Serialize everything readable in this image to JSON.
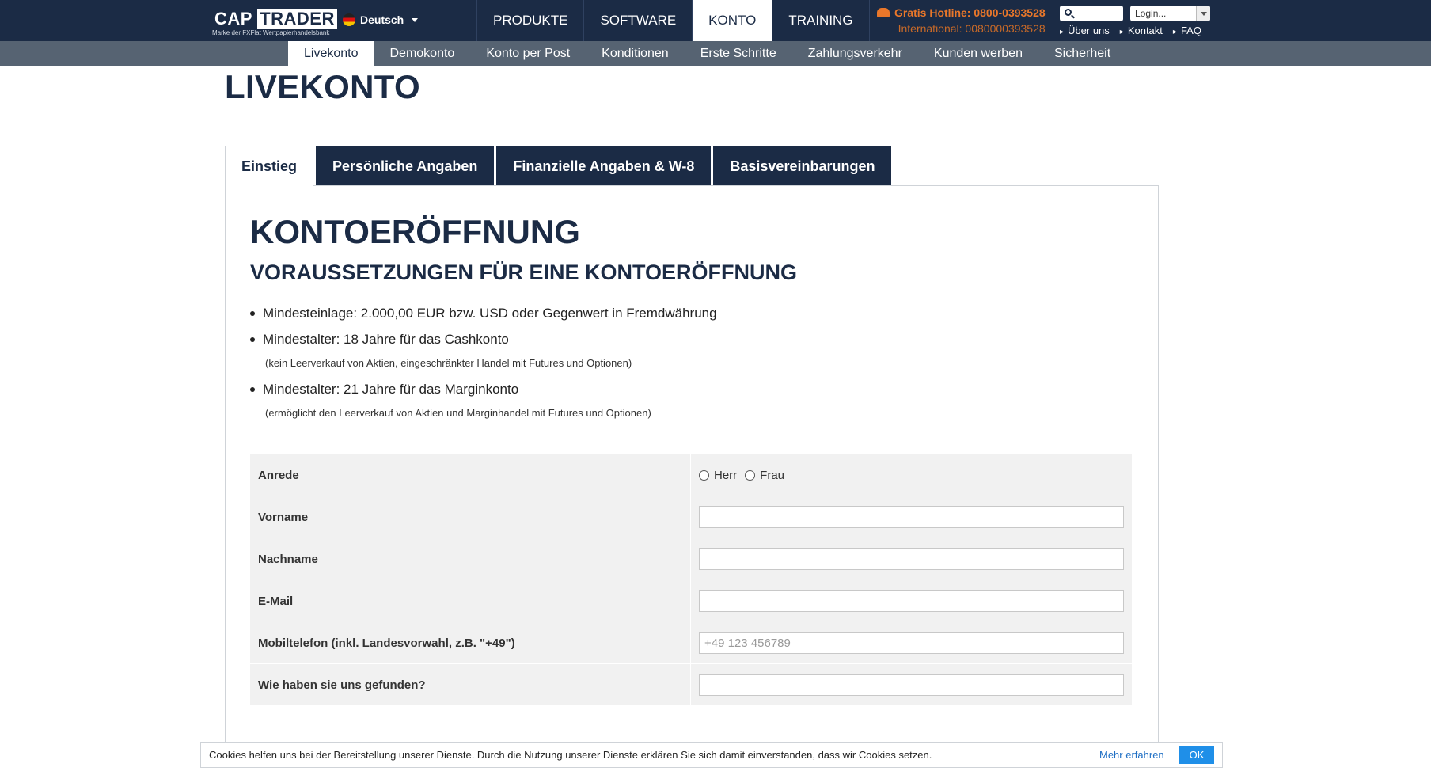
{
  "header": {
    "logo": {
      "brand_cap": "CAP",
      "brand_trader": "TRADER",
      "tagline": "Marke der FXFlat Wertpapierhandelsbank"
    },
    "language": "Deutsch",
    "main_nav": [
      "PRODUKTE",
      "SOFTWARE",
      "KONTO",
      "TRAINING"
    ],
    "active_main_nav": "KONTO",
    "hotline": "Gratis Hotline: 0800-0393528",
    "international": "International: 0080000393528",
    "search_placeholder": "",
    "login_label": "Login...",
    "top_links": [
      "Über uns",
      "Kontakt",
      "FAQ"
    ]
  },
  "subnav": {
    "items": [
      "Livekonto",
      "Demokonto",
      "Konto per Post",
      "Konditionen",
      "Erste Schritte",
      "Zahlungsverkehr",
      "Kunden werben",
      "Sicherheit"
    ],
    "active": "Livekonto"
  },
  "page_title": "LIVEKONTO",
  "tabs": [
    "Einstieg",
    "Persönliche Angaben",
    "Finanzielle Angaben & W-8",
    "Basisvereinbarungen"
  ],
  "active_tab": "Einstieg",
  "content": {
    "heading": "KONTOERÖFFNUNG",
    "subheading": "VORAUSSETZUNGEN FÜR EINE KONTOERÖFFNUNG",
    "requirements": [
      {
        "text": "Mindesteinlage: 2.000,00 EUR bzw. USD oder Gegenwert in Fremdwährung",
        "note": ""
      },
      {
        "text": "Mindestalter: 18 Jahre für das Cashkonto",
        "note": "(kein Leerverkauf von Aktien, eingeschränkter Handel mit Futures und Optionen)"
      },
      {
        "text": "Mindestalter: 21 Jahre für das Marginkonto",
        "note": "(ermöglicht den Leerverkauf von Aktien und Marginhandel mit Futures und Optionen)"
      }
    ]
  },
  "form": {
    "anrede_label": "Anrede",
    "anrede_options": [
      "Herr",
      "Frau"
    ],
    "vorname_label": "Vorname",
    "vorname_value": "",
    "nachname_label": "Nachname",
    "nachname_value": "",
    "email_label": "E-Mail",
    "email_value": "",
    "mobil_label": "Mobiltelefon (inkl. Landesvorwahl, z.B. \"+49\")",
    "mobil_placeholder": "+49 123 456789",
    "mobil_value": "",
    "found_label": "Wie haben sie uns gefunden?",
    "found_value": ""
  },
  "cookie": {
    "text": "Cookies helfen uns bei der Bereitstellung unserer Dienste. Durch die Nutzung unserer Dienste erklären Sie sich damit einverstanden, dass wir Cookies setzen.",
    "more": "Mehr erfahren",
    "ok": "OK"
  },
  "colors": {
    "navy": "#1b2b45",
    "subnav": "#566372",
    "orange": "#e9772a",
    "link_blue": "#1f6fc4",
    "ok_blue": "#1f8fe8"
  }
}
